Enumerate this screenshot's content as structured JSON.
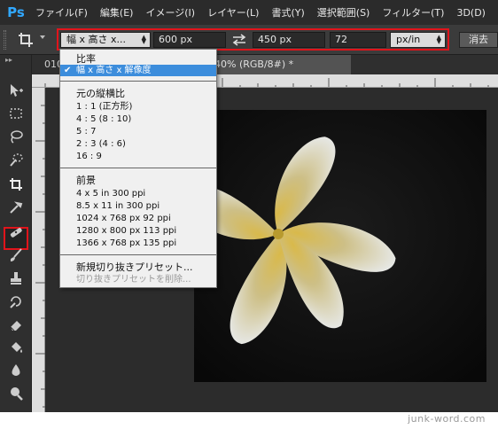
{
  "app": {
    "logo": "Ps",
    "accent": "#31a8ff"
  },
  "menubar": {
    "items": [
      "ファイル(F)",
      "編集(E)",
      "イメージ(I)",
      "レイヤー(L)",
      "書式(Y)",
      "選択範囲(S)",
      "フィルター(T)",
      "3D(D)"
    ]
  },
  "options": {
    "tool_icon": "crop-icon",
    "ratio_select": "幅 x 高さ x...",
    "width": "600 px",
    "swap_icon": "swap-arrows-icon",
    "height": "450 px",
    "resolution": "72",
    "unit": "px/in",
    "clear_label": "消去"
  },
  "tabs": {
    "first": "010",
    "active": "40% (RGB/8#) *"
  },
  "dropdown": {
    "ratio_header": "比率",
    "selected": "幅 x 高さ x 解像度",
    "original_ratio": "元の縦横比",
    "ratios": [
      "1 : 1 (正方形)",
      "4 : 5 (8 : 10)",
      "5 : 7",
      "2 : 3 (4 : 6)",
      "16 : 9"
    ],
    "presets_header": "前景",
    "presets": [
      "4 x 5 in 300 ppi",
      "8.5 x 11 in 300 ppi",
      "1024 x 768 px 92 ppi",
      "1280 x 800 px 113 ppi",
      "1366 x 768 px 135 ppi"
    ],
    "new_preset": "新規切り抜きプリセット...",
    "delete_preset": "切り抜きプリセットを削除..."
  },
  "toolbar": {
    "tools": [
      "move-icon",
      "marquee-icon",
      "lasso-icon",
      "quick-select-icon",
      "crop-icon",
      "eyedropper-icon",
      "healing-icon",
      "brush-icon",
      "stamp-icon",
      "history-brush-icon",
      "eraser-icon",
      "paint-bucket-icon",
      "blur-icon",
      "dodge-icon"
    ]
  },
  "highlight_color": "#e1141b",
  "watermark": "junk-word.com"
}
